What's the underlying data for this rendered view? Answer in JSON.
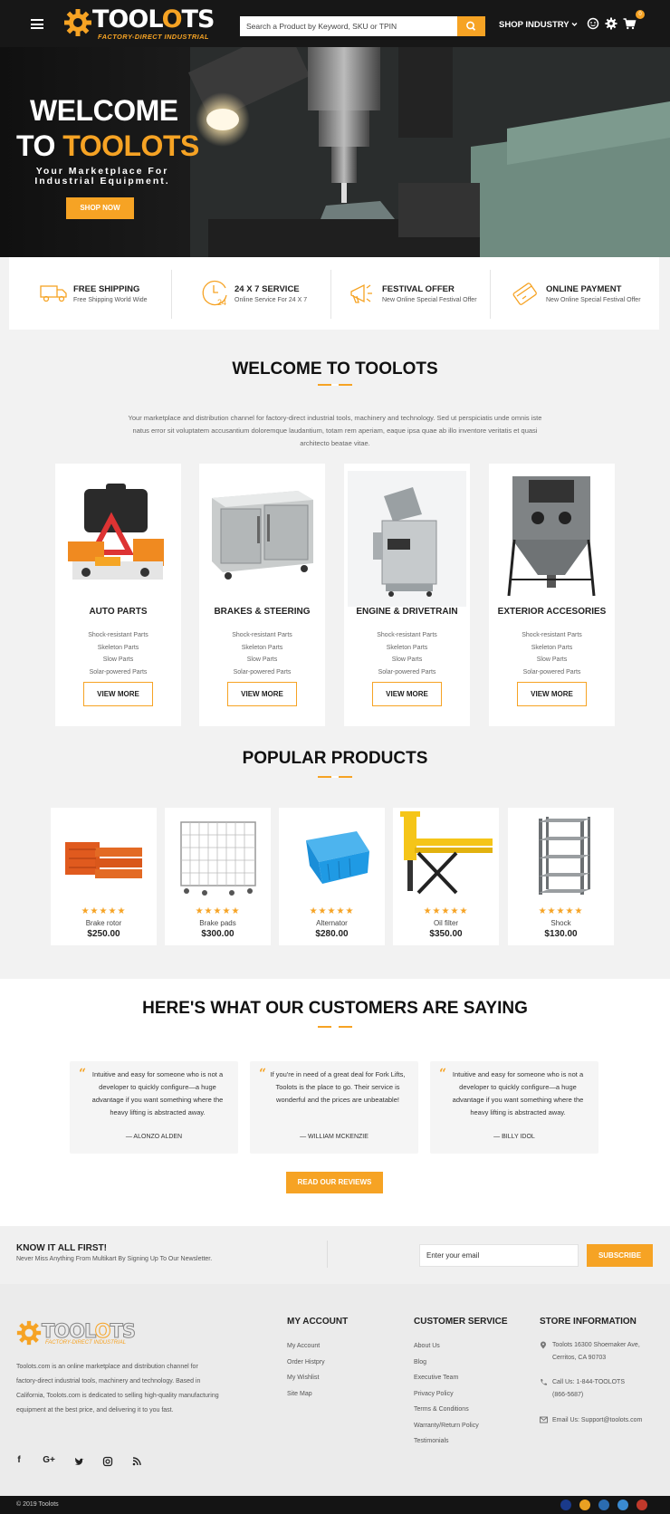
{
  "header": {
    "logo_text_a": "TOOL",
    "logo_text_b": "O",
    "logo_text_c": "TS",
    "logo_tagline": "FACTORY-DIRECT INDUSTRIAL",
    "search_placeholder": "Search a Product by Keyword, SKU or TPIN",
    "shop_industry": "SHOP INDUSTRY",
    "cart_count": "0",
    "icons": [
      "menu-icon",
      "search-icon",
      "chevron-down-icon",
      "user-icon",
      "gear-icon",
      "cart-icon"
    ]
  },
  "hero": {
    "line1": "WELCOME",
    "line2a": "TO ",
    "line2b": "TOOLOTS",
    "subtitle": "Your Marketplace For Industrial Equipment.",
    "button": "SHOP NOW"
  },
  "features": [
    {
      "title": "FREE SHIPPING",
      "subtitle": "Free Shipping World Wide",
      "icon": "truck-icon"
    },
    {
      "title": "24 X 7 SERVICE",
      "subtitle": "Online Service For 24 X 7",
      "icon": "clock-24-icon"
    },
    {
      "title": "FESTIVAL OFFER",
      "subtitle": "New Online Special Festival Offer",
      "icon": "megaphone-icon"
    },
    {
      "title": "ONLINE PAYMENT",
      "subtitle": "New Online Special Festival Offer",
      "icon": "credit-card-icon"
    }
  ],
  "welcome": {
    "title": "WELCOME TO TOOLOTS",
    "text": "Your marketplace and distribution channel for factory-direct industrial tools, machinery and technology. Sed ut perspiciatis unde omnis iste natus error sit voluptatem accusantium doloremque laudantium, totam rem aperiam, eaque ipsa quae ab illo inventore veritatis et quasi architecto beatae vitae."
  },
  "categories": [
    {
      "name": "AUTO PARTS",
      "items": [
        "Shock-resistant Parts",
        "Skeleton Parts",
        "Slow Parts",
        "Solar-powered Parts"
      ],
      "button": "VIEW MORE"
    },
    {
      "name": "BRAKES & STEERING",
      "items": [
        "Shock-resistant Parts",
        "Skeleton Parts",
        "Slow Parts",
        "Solar-powered Parts"
      ],
      "button": "VIEW MORE"
    },
    {
      "name": "ENGINE & DRIVETRAIN",
      "items": [
        "Shock-resistant Parts",
        "Skeleton Parts",
        "Slow Parts",
        "Solar-powered Parts"
      ],
      "button": "VIEW MORE"
    },
    {
      "name": "EXTERIOR ACCESORIES",
      "items": [
        "Shock-resistant Parts",
        "Skeleton Parts",
        "Slow Parts",
        "Solar-powered Parts"
      ],
      "button": "VIEW MORE"
    }
  ],
  "popular": {
    "title": "POPULAR PRODUCTS",
    "products": [
      {
        "name": "Brake rotor",
        "price": "$250.00",
        "rating": 5,
        "stars": "★★★★★"
      },
      {
        "name": "Brake pads",
        "price": "$300.00",
        "rating": 5,
        "stars": "★★★★★"
      },
      {
        "name": "Alternator",
        "price": "$280.00",
        "rating": 5,
        "stars": "★★★★★"
      },
      {
        "name": "Oil filter",
        "price": "$350.00",
        "rating": 5,
        "stars": "★★★★★"
      },
      {
        "name": "Shock",
        "price": "$130.00",
        "rating": 5,
        "stars": "★★★★★"
      }
    ]
  },
  "testimonials": {
    "title": "HERE'S WHAT OUR CUSTOMERS ARE SAYING",
    "items": [
      {
        "text": "Intuitive and easy for someone who is not a developer to quickly configure—a huge advantage if you want something where the heavy lifting is abstracted away.",
        "author": "— ALONZO ALDEN"
      },
      {
        "text": "If you're in need of a great deal for Fork Lifts, Toolots is the place to go. Their service is wonderful and the prices are unbeatable!",
        "author": "— WILLIAM MCKENZIE"
      },
      {
        "text": "Intuitive and easy for someone who is not a developer to quickly configure—a huge advantage if you want something where the heavy lifting is abstracted away.",
        "author": "— BILLY IDOL"
      }
    ],
    "button": "READ OUR REVIEWS"
  },
  "newsletter": {
    "title": "KNOW IT ALL FIRST!",
    "subtitle": "Never Miss Anything From Multikart By Signing Up To Our Newsletter.",
    "placeholder": "Enter your email",
    "button": "SUBSCRIBE"
  },
  "footer": {
    "about": "Toolots.com is an online marketplace and distribution channel for factory-direct industrial tools, machinery and technology. Based in California, Toolots.com is dedicated to selling high-quality manufacturing equipment at the best price, and delivering it to you fast.",
    "social": [
      "f",
      "G+",
      "twitter-icon",
      "instagram-icon",
      "rss-icon"
    ],
    "my_account": {
      "title": "MY ACCOUNT",
      "links": [
        "My Account",
        "Order Histpry",
        "My Wishlist",
        "Site Map"
      ]
    },
    "customer_service": {
      "title": "CUSTOMER SERVICE",
      "links": [
        "About Us",
        "Blog",
        "Executive Team",
        "Privacy Policy",
        "Terms & Conditions",
        "Warranty/Return Policy",
        "Testimonials"
      ]
    },
    "store": {
      "title": "STORE INFORMATION",
      "address1": "Toolots 16300 Shoemaker Ave,",
      "address2": "Cerritos, CA 90703",
      "phone1": "Call Us: 1-844-TOOLOTS",
      "phone2": "(866-5687)",
      "email": "Email Us: Support@toolots.com"
    },
    "copyright": "© 2019 Toolots",
    "payment_colors": [
      "#1a3a8a",
      "#e8a022",
      "#2b6cb0",
      "#3a8ad0",
      "#c0392b"
    ]
  },
  "colors": {
    "accent": "#f6a324",
    "header_bg": "#171717",
    "footer_bg": "#ebebeb"
  }
}
